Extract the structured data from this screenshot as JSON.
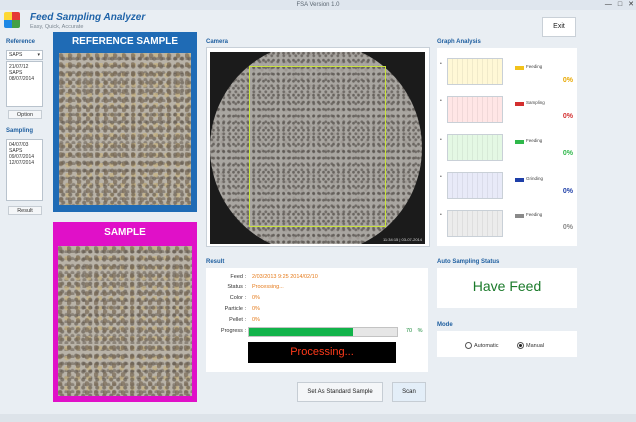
{
  "window": {
    "title": "FSA Version 1.0",
    "controls": [
      "—",
      "□",
      "✕"
    ]
  },
  "app": {
    "title": "Feed Sampling Analyzer",
    "subtitle": "Easy, Quick, Accurate"
  },
  "toolbar": {
    "exit_label": "Exit"
  },
  "reference": {
    "label": "Reference",
    "combo_value": "SAPS",
    "list": [
      "21/07/12",
      "SAPS",
      "08/07/2014"
    ],
    "option_button": "Option"
  },
  "sampling": {
    "label": "Sampling",
    "list": [
      "04/07/03",
      "SAPS",
      "09/07/2014",
      "12/07/2014"
    ],
    "result_button": "Result"
  },
  "reference_sample": {
    "header": "REFERENCE SAMPLE"
  },
  "sample": {
    "header": "SAMPLE"
  },
  "camera": {
    "label": "Camera",
    "timestamp": "11:34:15 | 03-07-2014"
  },
  "graph_analysis": {
    "label": "Graph Analysis",
    "items": [
      {
        "name": "Feeding",
        "percent": "0%",
        "color": "#f2c21b",
        "fill": "#fff8d6",
        "pct_color": "#e8a800"
      },
      {
        "name": "Sampling",
        "percent": "0%",
        "color": "#d32f2f",
        "fill": "#ffe6e6",
        "pct_color": "#d32f2f"
      },
      {
        "name": "Feeding",
        "percent": "0%",
        "color": "#2eb84a",
        "fill": "#e4f8e4",
        "pct_color": "#2eb84a"
      },
      {
        "name": "Grinding",
        "percent": "0%",
        "color": "#1e3fa8",
        "fill": "#e8eaf8",
        "pct_color": "#1e3fa8"
      },
      {
        "name": "Feeding",
        "percent": "0%",
        "color": "#8a8a8a",
        "fill": "#ececec",
        "pct_color": "#888888"
      }
    ]
  },
  "result": {
    "label": "Result",
    "rows": [
      {
        "key": "Feed :",
        "value": "2/03/2013 9:25 2014/02/10"
      },
      {
        "key": "Status :",
        "value": "Processing..."
      },
      {
        "key": "Color :",
        "value": "0%"
      },
      {
        "key": "Particle :",
        "value": "0%"
      },
      {
        "key": "Pellet :",
        "value": "0%"
      }
    ],
    "progress_label": "Progress :",
    "progress_value": 0.7,
    "progress_text": "70",
    "progress_unit": "%",
    "processing_text": "Processing..."
  },
  "auto_sampling": {
    "label": "Auto Sampling Status",
    "status": "Have Feed"
  },
  "mode": {
    "label": "Mode",
    "options": [
      "Automatic",
      "Manual"
    ],
    "selected": "Manual"
  },
  "actions": {
    "set_standard": "Set As Standard Sample",
    "scan": "Scan"
  }
}
